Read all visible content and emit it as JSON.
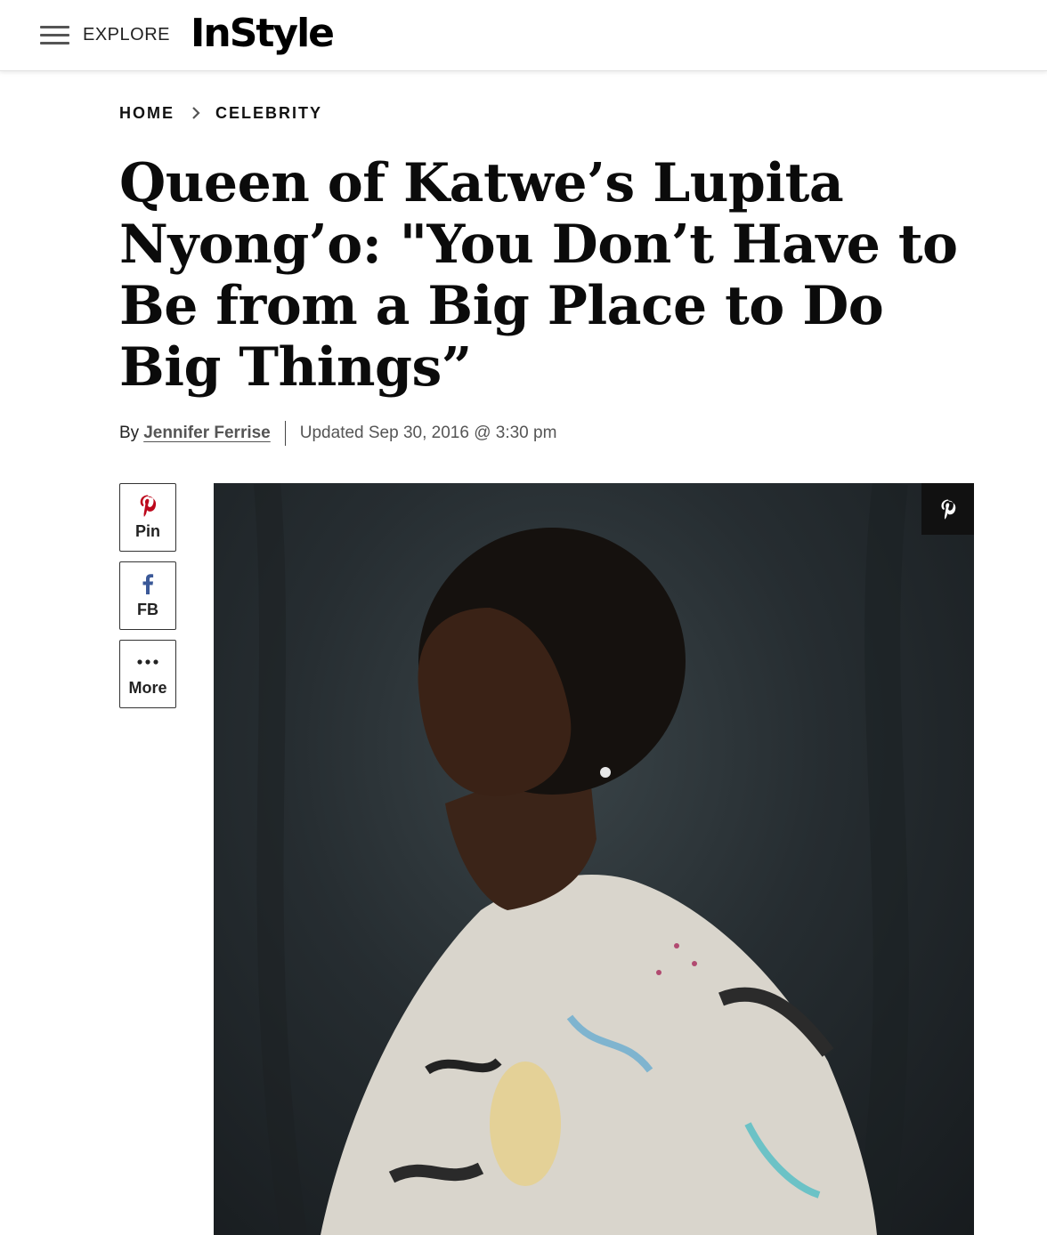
{
  "header": {
    "menu_label": "EXPLORE",
    "logo_text": "InStyle"
  },
  "breadcrumb": {
    "items": [
      "HOME",
      "CELEBRITY"
    ]
  },
  "article": {
    "title": "Queen of Katwe’s Lupita Nyong’o: \"You Don’t Have to Be from a Big Place to Do Big Things”",
    "byline_prefix": "By",
    "author": "Jennifer Ferrise",
    "updated": "Updated Sep 30, 2016 @ 3:30 pm"
  },
  "share": {
    "buttons": [
      {
        "label": "Pin",
        "icon": "pinterest-icon"
      },
      {
        "label": "FB",
        "icon": "facebook-icon"
      },
      {
        "label": "More",
        "icon": "more-dots-icon"
      }
    ]
  },
  "colors": {
    "pinterest": "#bd081c",
    "facebook": "#3b5998",
    "text": "#111111"
  }
}
